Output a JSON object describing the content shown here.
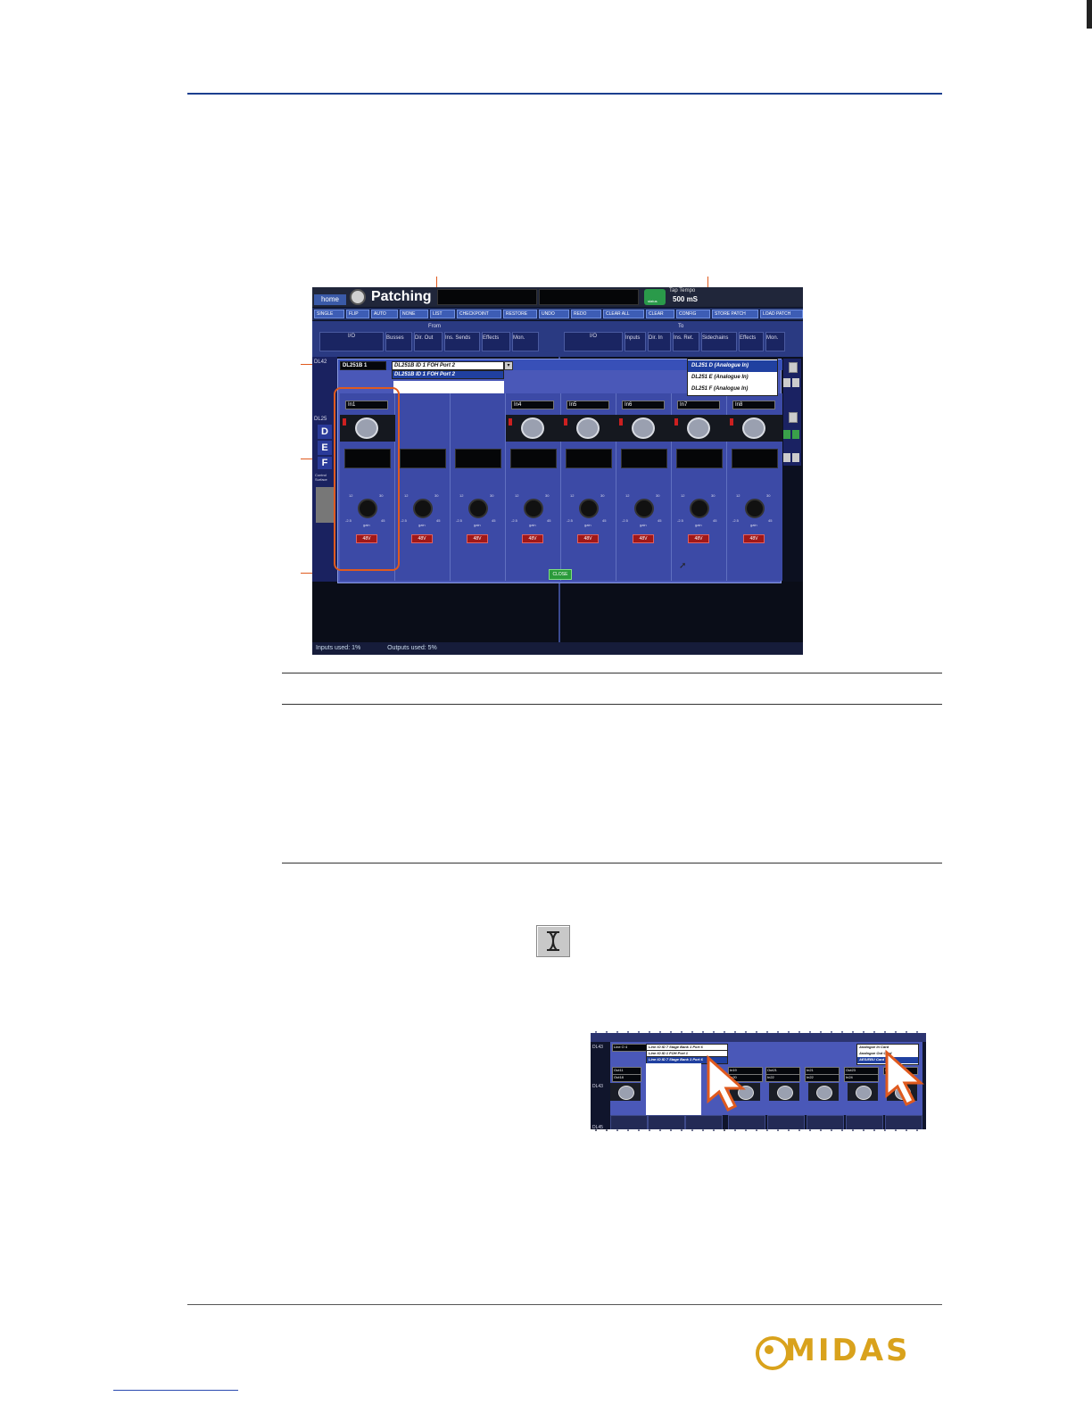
{
  "screenshot1": {
    "title": "Patching",
    "home_label": "home",
    "tap_tempo_label": "Tap Tempo",
    "tap_tempo_value": "500 mS",
    "status_label": "status",
    "toolbar_buttons": [
      "SINGLE",
      "FLIP",
      "AUTO",
      "NONE",
      "LIST",
      "CHECKPOINT",
      "RESTORE",
      "UNDO",
      "REDO",
      "CLEAR ALL",
      "CLEAR",
      "CONFIG",
      "STORE PATCH",
      "LOAD PATCH"
    ],
    "from_label": "From",
    "to_label": "To",
    "from_tabs": [
      "I/O",
      "Busses",
      "Dir. Out",
      "Ins. Sends",
      "Effects",
      "Mon."
    ],
    "to_tabs": [
      "I/O",
      "Inputs",
      "Dir. In",
      "Ins. Ret.",
      "Sidechains",
      "Effects",
      "Mon."
    ],
    "left_rows": [
      "DL42",
      "DL25"
    ],
    "left_letters": [
      "D",
      "E",
      "F"
    ],
    "control_label": "Control Surface",
    "device_field": "DL251B 1",
    "port_combo": "DL251B ID 1 FOH Port 2",
    "port_option_selected": "DL251B ID 1 FOH Port 2",
    "right_options": [
      "DL251 D (Analogue In)",
      "DL251 E (Analogue In)",
      "DL251 F (Analogue In)"
    ],
    "channels": [
      {
        "label": "In1"
      },
      {
        "label": ""
      },
      {
        "label": ""
      },
      {
        "label": "In4"
      },
      {
        "label": "In5"
      },
      {
        "label": "In6"
      },
      {
        "label": "In7"
      },
      {
        "label": "In8"
      }
    ],
    "knob_ticks_top_left": "12",
    "knob_ticks_top_right": "30",
    "knob_ticks_bottom_left": "-2.5",
    "knob_ticks_bottom_right": "45",
    "knob_caption": "gain",
    "phantom_label": "48V",
    "close_label": "CLOSE",
    "status_inputs": "Inputs used: 1%",
    "status_outputs": "Outputs used: 5%"
  },
  "screenshot2": {
    "row_labels": [
      "DL43",
      "DL43",
      "DL45"
    ],
    "device_field": "Line O 4",
    "combo_selected": "Line IO ID 7 Stage Bank 1 Port 6",
    "combo_options": [
      "Line IO ID 1 FOH Port 1",
      "Line IO ID 7 Stage Bank 1 Port 6"
    ],
    "right_options": [
      "Analogue In Card",
      "Analogue Out Card",
      "AES/EBU Card"
    ],
    "channel_labels": [
      "Out11",
      "In19",
      "Out21",
      "In21",
      "Out23",
      "In23"
    ],
    "sub_labels": [
      "Out18",
      "In20",
      "In22",
      "In22",
      "In24"
    ]
  },
  "logo_text": "MIDAS",
  "colors": {
    "rule_blue": "#1c3f8f",
    "callout_orange": "#e05a1e",
    "panel_blue": "#4a58b8",
    "logo_gold": "#d9a21c"
  },
  "icons": [
    "connect-icon",
    "arrow-pointer-icon"
  ]
}
